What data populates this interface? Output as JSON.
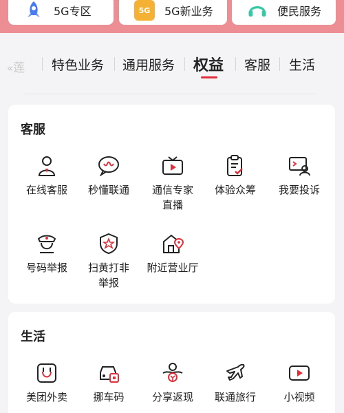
{
  "shortcuts": [
    {
      "label": "5G专区",
      "icon": "rocket-icon",
      "badge": ""
    },
    {
      "label": "5G新业务",
      "icon": "5g-badge-icon",
      "badge": "5G"
    },
    {
      "label": "便民服务",
      "icon": "headset-icon",
      "badge": ""
    }
  ],
  "tabs": {
    "partial": "莲",
    "items": [
      "特色业务",
      "通用服务",
      "权益",
      "客服",
      "生活"
    ],
    "active": "权益"
  },
  "service_section": {
    "title": "客服",
    "items": [
      {
        "label": "在线客服",
        "icon": "person-icon"
      },
      {
        "label": "秒懂联通",
        "icon": "chat-bubble-icon"
      },
      {
        "label": "通信专家\n直播",
        "icon": "tv-play-icon"
      },
      {
        "label": "体验众筹",
        "icon": "clipboard-check-icon"
      },
      {
        "label": "我要投诉",
        "icon": "complaint-monitor-icon"
      },
      {
        "label": "号码举报",
        "icon": "police-officer-icon"
      },
      {
        "label": "扫黄打非\n举报",
        "icon": "shield-star-icon"
      },
      {
        "label": "附近营业厅",
        "icon": "store-location-icon"
      }
    ]
  },
  "life_section": {
    "title": "生活",
    "items": [
      {
        "label": "美团外卖",
        "icon": "meituan-kangaroo-icon"
      },
      {
        "label": "挪车码",
        "icon": "car-qr-icon"
      },
      {
        "label": "分享返现",
        "icon": "share-cashback-icon"
      },
      {
        "label": "联通旅行",
        "icon": "airplane-icon"
      },
      {
        "label": "小视频",
        "icon": "video-camera-icon"
      }
    ]
  },
  "colors": {
    "accent": "#e02e3b",
    "top_band": "#ec8e93",
    "rocket": "#4a7cf0",
    "badge_5g": "#f4b133",
    "headset": "#35c9a6"
  }
}
